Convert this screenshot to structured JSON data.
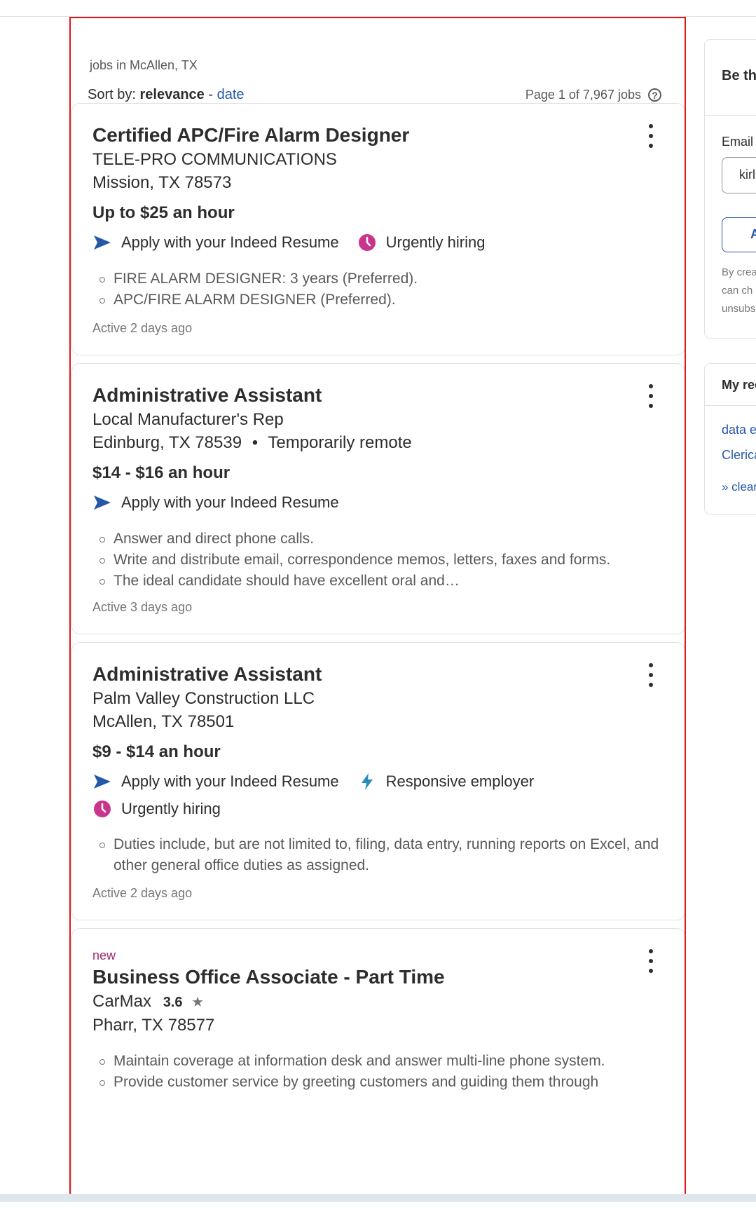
{
  "search": {
    "title": "jobs in McAllen, TX",
    "sort_prefix": "Sort by:",
    "sort_relevance": "relevance",
    "sort_sep": "-",
    "sort_date": "date",
    "page_info": "Page 1 of 7,967 jobs"
  },
  "jobs": [
    {
      "title": "Certified APC/Fire Alarm Designer",
      "company": "TELE-PRO COMMUNICATIONS",
      "location": "Mission, TX 78573",
      "salary": "Up to $25 an hour",
      "features": [
        "Apply with your Indeed Resume",
        "Urgently hiring"
      ],
      "snippets": [
        "FIRE ALARM DESIGNER: 3 years (Preferred).",
        "APC/FIRE ALARM DESIGNER (Preferred)."
      ],
      "active": "Active 2 days ago"
    },
    {
      "title": "Administrative Assistant",
      "company": "Local Manufacturer's Rep",
      "location": "Edinburg, TX 78539",
      "location_sep": "•",
      "location_extra": "Temporarily remote",
      "salary": "$14 - $16 an hour",
      "features": [
        "Apply with your Indeed Resume"
      ],
      "snippets": [
        "Answer and direct phone calls.",
        "Write and distribute email, correspondence memos, letters, faxes and forms.",
        "The ideal candidate should have excellent oral and…"
      ],
      "active": "Active 3 days ago"
    },
    {
      "title": "Administrative Assistant",
      "company": "Palm Valley Construction LLC",
      "location": "McAllen, TX 78501",
      "salary": "$9 - $14 an hour",
      "features": [
        "Apply with your Indeed Resume",
        "Responsive employer",
        "Urgently hiring"
      ],
      "snippets": [
        "Duties include, but are not limited to, filing, data entry, running reports on Excel, and other general office duties as assigned."
      ],
      "active": "Active 2 days ago"
    },
    {
      "new_label": "new",
      "title": "Business Office Associate - Part Time",
      "company": "CarMax",
      "rating": "3.6",
      "location": "Pharr, TX 78577",
      "snippets": [
        "Maintain coverage at information desk and answer multi-line phone system.",
        "Provide customer service by greeting customers and guiding them through"
      ]
    }
  ],
  "sidebar": {
    "alert_heading": "Be th",
    "email_label": "Email",
    "email_value": "kirl",
    "button_label": "A",
    "disclaimer": [
      "By crea",
      "can ch",
      "unsubs"
    ],
    "recent_heading": "My rec",
    "recent_links": [
      "data e",
      "Clerica",
      "» clear"
    ]
  },
  "colors": {
    "accent": "#2557a7",
    "urgent": "#c9348c",
    "responsive": "#2a8bbd",
    "highlight_border": "#e0161c"
  }
}
